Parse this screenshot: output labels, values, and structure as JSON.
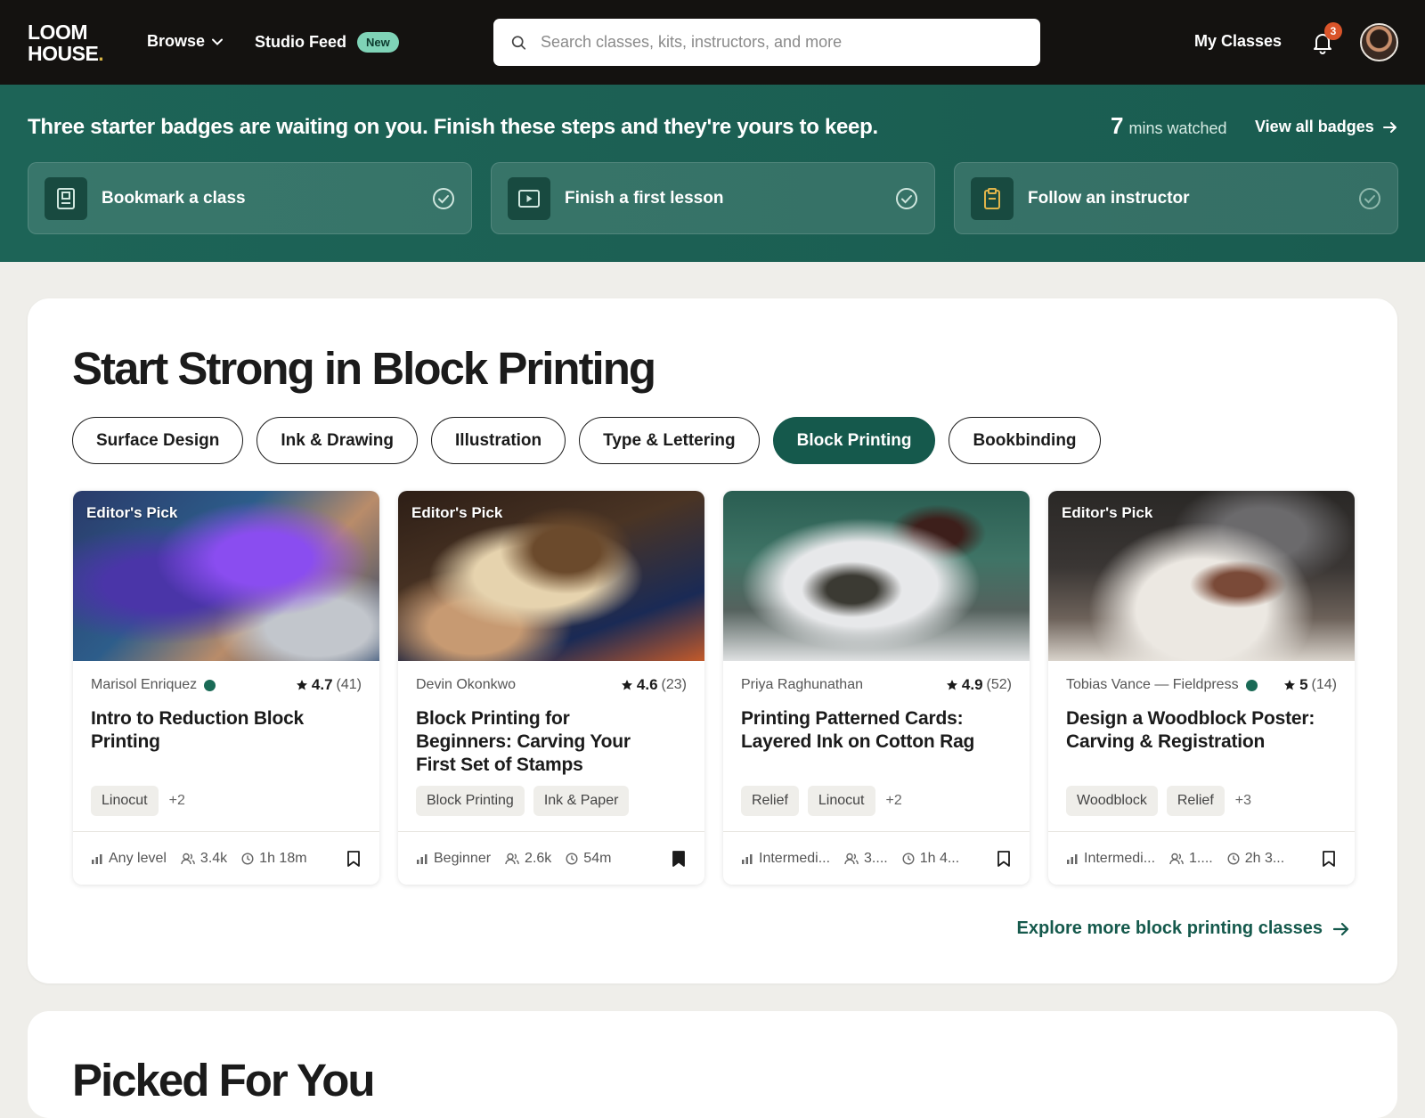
{
  "nav": {
    "logo_line1": "LOOM",
    "logo_line2": "HOUSE",
    "logo_dot": ".",
    "browse": "Browse",
    "studio_feed": "Studio Feed",
    "new_badge": "New",
    "search_placeholder": "Search classes, kits, instructors, and more",
    "my_classes": "My Classes",
    "notification_count": "3"
  },
  "banner": {
    "title": "Three starter badges are waiting on you. Finish these steps and they're yours to keep.",
    "mins_value": "7",
    "mins_label": "mins watched",
    "view_all": "View all badges",
    "steps": [
      {
        "label": "Bookmark a class",
        "icon": "bookmark-book-icon"
      },
      {
        "label": "Finish a first lesson",
        "icon": "play-icon"
      },
      {
        "label": "Follow an instructor",
        "icon": "clipboard-icon"
      }
    ]
  },
  "section": {
    "title": "Start Strong in Block Printing",
    "chips": [
      "Surface Design",
      "Ink & Drawing",
      "Illustration",
      "Type & Lettering",
      "Block Printing",
      "Bookbinding"
    ],
    "active_chip": "Block Printing",
    "courses": [
      {
        "badge": "Editor's Pick",
        "instructor": "Marisol Enriquez",
        "verified": true,
        "rating": "4.7",
        "reviews": "(41)",
        "title": "Intro to Reduction Block Printing",
        "tags": [
          "Linocut"
        ],
        "more": "+2",
        "level": "Any level",
        "students": "3.4k",
        "duration": "1h 18m",
        "bookmarked": false
      },
      {
        "badge": "Editor's Pick",
        "instructor": "Devin Okonkwo",
        "verified": false,
        "rating": "4.6",
        "reviews": "(23)",
        "title": "Block Printing for Beginners: Carving Your First Set of Stamps",
        "tags": [
          "Block Printing",
          "Ink & Paper"
        ],
        "more": "",
        "level": "Beginner",
        "students": "2.6k",
        "duration": "54m",
        "bookmarked": true
      },
      {
        "badge": "",
        "instructor": "Priya Raghunathan",
        "verified": false,
        "rating": "4.9",
        "reviews": "(52)",
        "title": "Printing Patterned Cards: Layered Ink on Cotton Rag",
        "tags": [
          "Relief",
          "Linocut"
        ],
        "more": "+2",
        "level": "Intermedi...",
        "students": "3....",
        "duration": "1h 4...",
        "bookmarked": false
      },
      {
        "badge": "Editor's Pick",
        "instructor": "Tobias Vance — Fieldpress",
        "verified": true,
        "rating": "5",
        "reviews": "(14)",
        "title": "Design a Woodblock Poster: Carving & Registration",
        "tags": [
          "Woodblock",
          "Relief"
        ],
        "more": "+3",
        "level": "Intermedi...",
        "students": "1....",
        "duration": "2h 3...",
        "bookmarked": false
      }
    ],
    "explore": "Explore more block printing classes"
  },
  "next_section_title": "Picked For You",
  "colors": {
    "brand_green": "#15594c",
    "banner_green": "#1d6457",
    "notification": "#d9542a",
    "new_badge": "#7fd3b7"
  }
}
